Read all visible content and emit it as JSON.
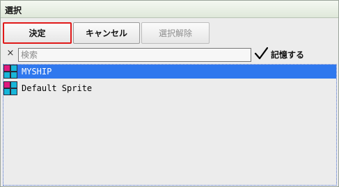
{
  "window": {
    "title": "選択"
  },
  "toolbar": {
    "ok_label": "決定",
    "cancel_label": "キャンセル",
    "deselect_label": "選択解除"
  },
  "search": {
    "placeholder": "検索",
    "value": "",
    "clear_icon": "×"
  },
  "remember": {
    "label": "記憶する",
    "checked": true
  },
  "list": {
    "items": [
      {
        "label": "MYSHIP",
        "selected": true,
        "icon": "sprite-icon"
      },
      {
        "label": "Default Sprite",
        "selected": false,
        "icon": "sprite-icon"
      }
    ]
  },
  "colors": {
    "selection": "#2f78ee",
    "ok_border": "#e01818",
    "icon_magenta": "#e0197f",
    "icon_cyan": "#17b6d9",
    "icon_dark": "#2a2a3a"
  }
}
